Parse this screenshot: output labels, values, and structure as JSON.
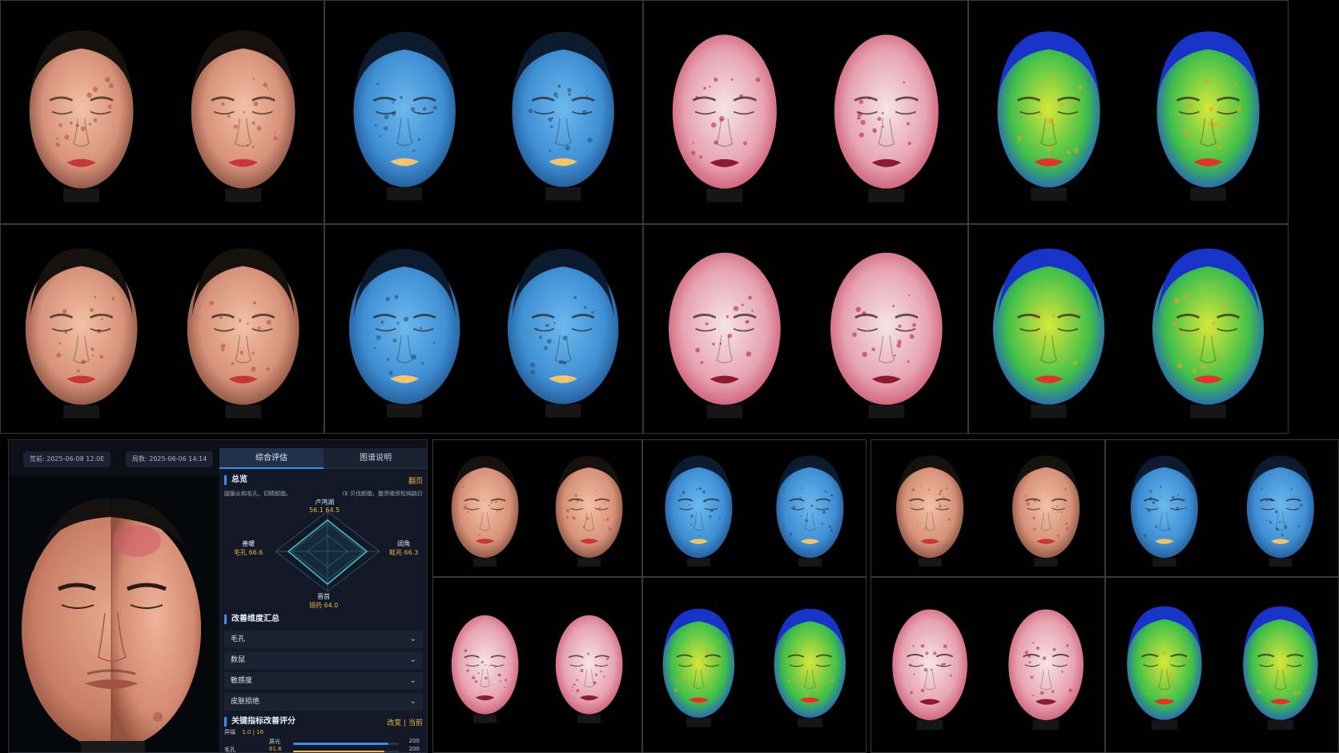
{
  "app": {
    "date_before": "荒前: 2025-06-08 12:0E",
    "date_after": "局数: 2025-06-06 14:14",
    "tabs": [
      {
        "label": "综合评估",
        "active": true
      },
      {
        "label": "图谱说明",
        "active": false
      }
    ],
    "overview_title": "总览",
    "overview_link": "翻页",
    "summary_left": "腿腺炎和毛孔，切精颜脂。",
    "summary_right": "(E 贝伐颜脂，整资微资松纯路衍",
    "radar": {
      "top_label": "卢鸿湖",
      "top_value": "56.1 64.5",
      "left_label": "善暖",
      "left_value": "毛孔 66.6",
      "right_label": "阔角",
      "right_value": "鲑兆 66.3",
      "bottom_label": "晋首",
      "bottom_value": "镜药 64.0"
    },
    "dimension_title": "改善维度汇总",
    "dimensions": [
      "毛孔",
      "数鼠",
      "敏感度",
      "皮肤损绝"
    ],
    "key_metrics_title": "关键指标改善评分",
    "key_metrics_link": "改变 | 当前",
    "metrics_header": "异端",
    "metrics_header_values": "1.0 | 16",
    "metrics": [
      {
        "label": "屏光",
        "left": "",
        "value": "200",
        "fraction": 0.9,
        "color": "#3a8fe8"
      },
      {
        "label": "毛孔",
        "left": "61.6",
        "value": "200",
        "fraction": 0.86,
        "color": "#f0b540"
      }
    ]
  },
  "colors": {
    "accent": "#3a8fe8",
    "highlight": "#f0b540",
    "panel_bg": "#121826"
  }
}
